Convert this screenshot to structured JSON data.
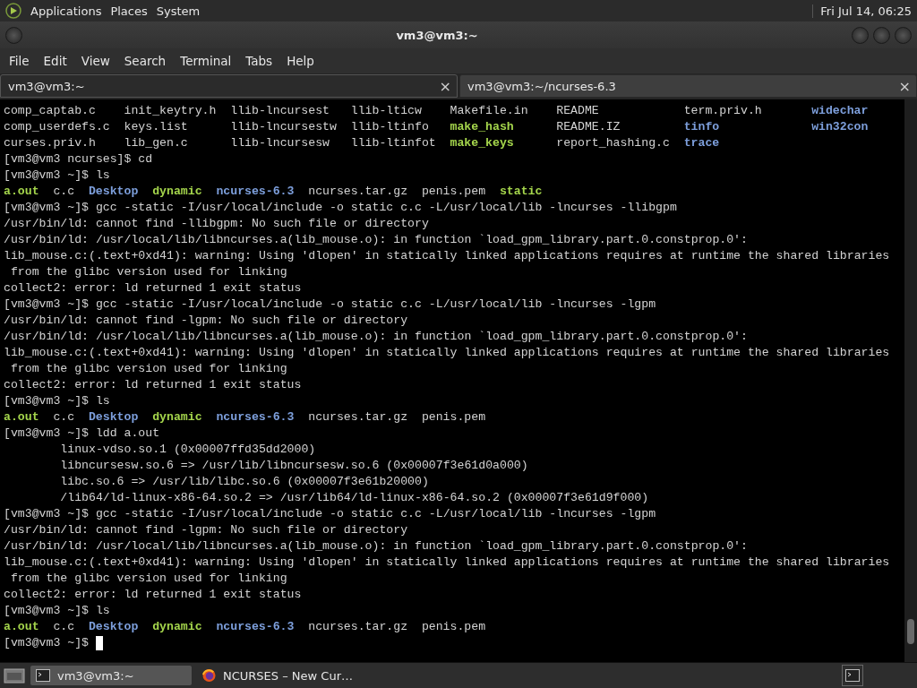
{
  "top_panel": {
    "menus": [
      "Applications",
      "Places",
      "System"
    ],
    "clock": "Fri Jul 14, 06:25"
  },
  "window": {
    "title": "vm3@vm3:~"
  },
  "menubar": [
    "File",
    "Edit",
    "View",
    "Search",
    "Terminal",
    "Tabs",
    "Help"
  ],
  "tabs": [
    {
      "label": "vm3@vm3:~",
      "selected": true,
      "close": "×"
    },
    {
      "label": "vm3@vm3:~/ncurses-6.3",
      "selected": false,
      "close": "×"
    }
  ],
  "terminal": {
    "lines": [
      {
        "kind": "grid",
        "entries": [
          {
            "name": "comp_captab.c",
            "kind": "file"
          },
          {
            "name": "init_keytry.h",
            "kind": "file"
          },
          {
            "name": "llib-lncursest",
            "kind": "file"
          },
          {
            "name": "llib-lticw",
            "kind": "file"
          },
          {
            "name": "Makefile.in",
            "kind": "file"
          },
          {
            "name": "README",
            "kind": "file"
          },
          {
            "name": "term.priv.h",
            "kind": "file"
          },
          {
            "name": "widechar",
            "kind": "dir"
          }
        ]
      },
      {
        "kind": "grid",
        "entries": [
          {
            "name": "comp_userdefs.c",
            "kind": "file"
          },
          {
            "name": "keys.list",
            "kind": "file"
          },
          {
            "name": "llib-lncursestw",
            "kind": "file"
          },
          {
            "name": "llib-ltinfo",
            "kind": "file"
          },
          {
            "name": "make_hash",
            "kind": "exec"
          },
          {
            "name": "README.IZ",
            "kind": "file"
          },
          {
            "name": "tinfo",
            "kind": "dir"
          },
          {
            "name": "win32con",
            "kind": "dir"
          }
        ]
      },
      {
        "kind": "grid",
        "entries": [
          {
            "name": "curses.priv.h",
            "kind": "file"
          },
          {
            "name": "lib_gen.c",
            "kind": "file"
          },
          {
            "name": "llib-lncursesw",
            "kind": "file"
          },
          {
            "name": "llib-ltinfot",
            "kind": "file"
          },
          {
            "name": "make_keys",
            "kind": "exec"
          },
          {
            "name": "report_hashing.c",
            "kind": "file"
          },
          {
            "name": "trace",
            "kind": "dir"
          }
        ]
      },
      {
        "kind": "text",
        "text": "[vm3@vm3 ncurses]$ cd"
      },
      {
        "kind": "text",
        "text": "[vm3@vm3 ~]$ ls"
      },
      {
        "kind": "ls",
        "entries": [
          {
            "name": "a.out",
            "kind": "exec"
          },
          {
            "name": "c.c",
            "kind": "file"
          },
          {
            "name": "Desktop",
            "kind": "dir"
          },
          {
            "name": "dynamic",
            "kind": "exec"
          },
          {
            "name": "ncurses-6.3",
            "kind": "dir"
          },
          {
            "name": "ncurses.tar.gz",
            "kind": "file"
          },
          {
            "name": "penis.pem",
            "kind": "file"
          },
          {
            "name": "static",
            "kind": "exec"
          }
        ]
      },
      {
        "kind": "text",
        "text": "[vm3@vm3 ~]$ gcc -static -I/usr/local/include -o static c.c -L/usr/local/lib -lncurses -llibgpm"
      },
      {
        "kind": "text",
        "text": "/usr/bin/ld: cannot find -llibgpm: No such file or directory"
      },
      {
        "kind": "text",
        "text": "/usr/bin/ld: /usr/local/lib/libncurses.a(lib_mouse.o): in function `load_gpm_library.part.0.constprop.0':"
      },
      {
        "kind": "text",
        "text": "lib_mouse.c:(.text+0xd41): warning: Using 'dlopen' in statically linked applications requires at runtime the shared libraries"
      },
      {
        "kind": "text",
        "text": " from the glibc version used for linking"
      },
      {
        "kind": "text",
        "text": "collect2: error: ld returned 1 exit status"
      },
      {
        "kind": "text",
        "text": "[vm3@vm3 ~]$ gcc -static -I/usr/local/include -o static c.c -L/usr/local/lib -lncurses -lgpm"
      },
      {
        "kind": "text",
        "text": "/usr/bin/ld: cannot find -lgpm: No such file or directory"
      },
      {
        "kind": "text",
        "text": "/usr/bin/ld: /usr/local/lib/libncurses.a(lib_mouse.o): in function `load_gpm_library.part.0.constprop.0':"
      },
      {
        "kind": "text",
        "text": "lib_mouse.c:(.text+0xd41): warning: Using 'dlopen' in statically linked applications requires at runtime the shared libraries"
      },
      {
        "kind": "text",
        "text": " from the glibc version used for linking"
      },
      {
        "kind": "text",
        "text": "collect2: error: ld returned 1 exit status"
      },
      {
        "kind": "text",
        "text": "[vm3@vm3 ~]$ ls"
      },
      {
        "kind": "ls",
        "entries": [
          {
            "name": "a.out",
            "kind": "exec"
          },
          {
            "name": "c.c",
            "kind": "file"
          },
          {
            "name": "Desktop",
            "kind": "dir"
          },
          {
            "name": "dynamic",
            "kind": "exec"
          },
          {
            "name": "ncurses-6.3",
            "kind": "dir"
          },
          {
            "name": "ncurses.tar.gz",
            "kind": "file"
          },
          {
            "name": "penis.pem",
            "kind": "file"
          }
        ]
      },
      {
        "kind": "text",
        "text": "[vm3@vm3 ~]$ ldd a.out"
      },
      {
        "kind": "text",
        "text": "        linux-vdso.so.1 (0x00007ffd35dd2000)"
      },
      {
        "kind": "text",
        "text": "        libncursesw.so.6 => /usr/lib/libncursesw.so.6 (0x00007f3e61d0a000)"
      },
      {
        "kind": "text",
        "text": "        libc.so.6 => /usr/lib/libc.so.6 (0x00007f3e61b20000)"
      },
      {
        "kind": "text",
        "text": "        /lib64/ld-linux-x86-64.so.2 => /usr/lib64/ld-linux-x86-64.so.2 (0x00007f3e61d9f000)"
      },
      {
        "kind": "text",
        "text": "[vm3@vm3 ~]$ gcc -static -I/usr/local/include -o static c.c -L/usr/local/lib -lncurses -lgpm"
      },
      {
        "kind": "text",
        "text": "/usr/bin/ld: cannot find -lgpm: No such file or directory"
      },
      {
        "kind": "text",
        "text": "/usr/bin/ld: /usr/local/lib/libncurses.a(lib_mouse.o): in function `load_gpm_library.part.0.constprop.0':"
      },
      {
        "kind": "text",
        "text": "lib_mouse.c:(.text+0xd41): warning: Using 'dlopen' in statically linked applications requires at runtime the shared libraries"
      },
      {
        "kind": "text",
        "text": " from the glibc version used for linking"
      },
      {
        "kind": "text",
        "text": "collect2: error: ld returned 1 exit status"
      },
      {
        "kind": "text",
        "text": "[vm3@vm3 ~]$ ls"
      },
      {
        "kind": "ls",
        "entries": [
          {
            "name": "a.out",
            "kind": "exec"
          },
          {
            "name": "c.c",
            "kind": "file"
          },
          {
            "name": "Desktop",
            "kind": "dir"
          },
          {
            "name": "dynamic",
            "kind": "exec"
          },
          {
            "name": "ncurses-6.3",
            "kind": "dir"
          },
          {
            "name": "ncurses.tar.gz",
            "kind": "file"
          },
          {
            "name": "penis.pem",
            "kind": "file"
          }
        ]
      },
      {
        "kind": "prompt",
        "text": "[vm3@vm3 ~]$"
      }
    ]
  },
  "taskbar": {
    "items": [
      {
        "label": "vm3@vm3:~",
        "kind": "terminal",
        "selected": true
      },
      {
        "label": "NCURSES – New Cur…",
        "kind": "browser",
        "selected": false
      }
    ]
  }
}
